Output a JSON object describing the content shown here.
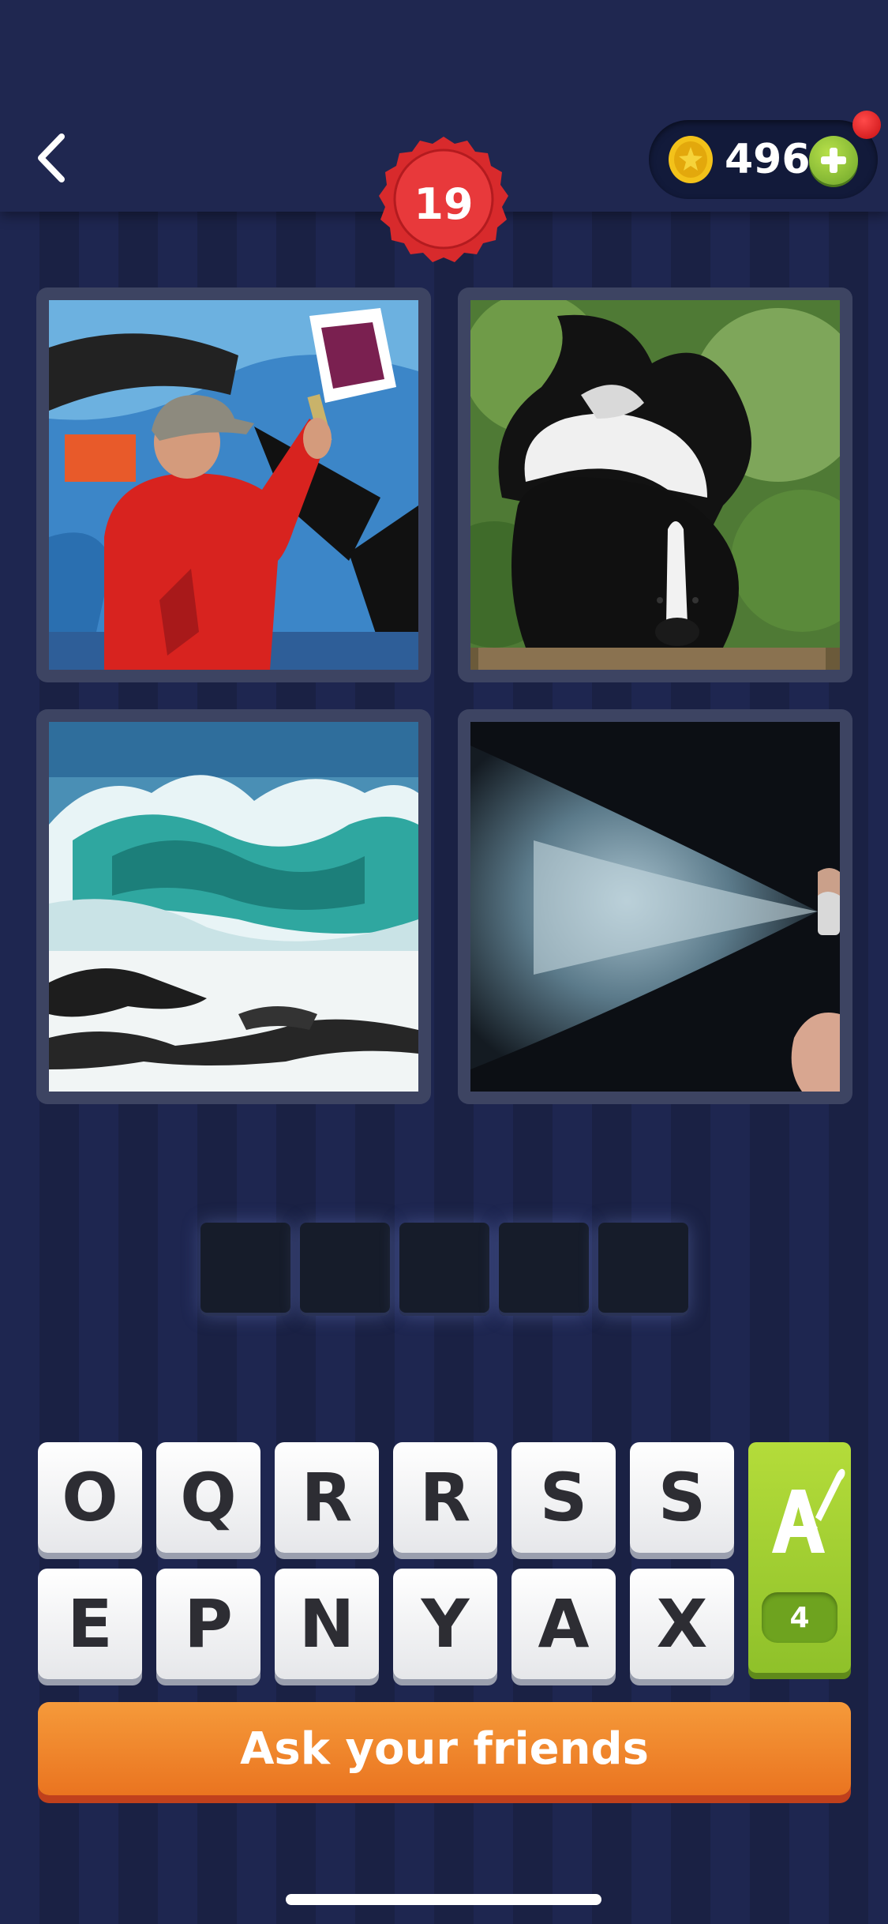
{
  "header": {
    "coins": "496",
    "level": "19"
  },
  "answer": {
    "slots": [
      "",
      "",
      "",
      "",
      ""
    ]
  },
  "keyboard": {
    "row1": [
      "O",
      "Q",
      "R",
      "R",
      "S",
      "S"
    ],
    "row2": [
      "E",
      "P",
      "N",
      "Y",
      "A",
      "X"
    ],
    "hint_count": "4"
  },
  "actions": {
    "ask_friends": "Ask your friends"
  },
  "colors": {
    "background": "#1c2347",
    "accent_orange": "#ea7420",
    "accent_green": "#8fc12a",
    "badge_red": "#d8262a"
  },
  "icons": {
    "back": "chevron-left-icon",
    "coin": "coin-icon",
    "add": "plus-icon",
    "hint": "paintbrush-letter-icon"
  }
}
